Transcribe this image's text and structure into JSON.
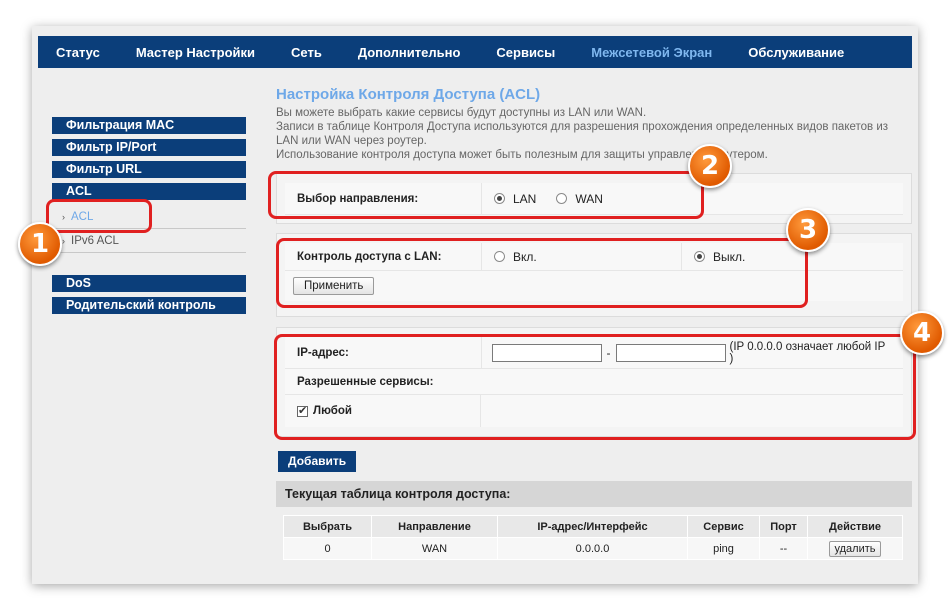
{
  "nav": {
    "items": [
      {
        "label": "Статус"
      },
      {
        "label": "Мастер Настройки"
      },
      {
        "label": "Сеть"
      },
      {
        "label": "Дополнительно"
      },
      {
        "label": "Сервисы"
      },
      {
        "label": "Межсетевой Экран"
      },
      {
        "label": "Обслуживание"
      }
    ]
  },
  "sidebar": {
    "mac": "Фильтрация MAC",
    "ipport": "Фильтр IP/Port",
    "url": "Фильтр URL",
    "acl": "ACL",
    "acl_sub": "ACL",
    "ipv6_sub": "IPv6 ACL",
    "dos": "DoS",
    "parental": "Родительский контроль"
  },
  "page": {
    "title": "Настройка Контроля Доступа (ACL)",
    "desc1": "Вы можете выбрать какие сервисы будут доступны из LAN или WAN.",
    "desc2": "Записи в таблице Контроля Доступа используются для разрешения прохождения определенных видов пакетов из LAN или WAN через роутер.",
    "desc3": "Использование контроля доступа может быть полезным для защиты управления роутером."
  },
  "direction": {
    "label": "Выбор направления:",
    "lan": "LAN",
    "wan": "WAN"
  },
  "lan_control": {
    "label": "Контроль доступа с LAN:",
    "on": "Вкл.",
    "off": "Выкл.",
    "apply": "Применить"
  },
  "ip_form": {
    "ip_label": "IP-адрес:",
    "dash": "-",
    "hint": "(IP 0.0.0.0 означает любой IP )",
    "services_label": "Разрешенные сервисы:",
    "any_label": "Любой"
  },
  "add_button": "Добавить",
  "table": {
    "title": "Текущая таблица контроля доступа:",
    "headers": [
      "Выбрать",
      "Направление",
      "IP-адрес/Интерфейс",
      "Сервис",
      "Порт",
      "Действие"
    ],
    "rows": [
      {
        "select": "0",
        "direction": "WAN",
        "ip": "0.0.0.0",
        "service": "ping",
        "port": "--",
        "action": "удалить"
      }
    ]
  },
  "badges": [
    "1",
    "2",
    "3",
    "4"
  ],
  "colors": {
    "nav_bg": "#0b3e7a",
    "accent": "#6ea8e8",
    "callout": "#e02020",
    "badge": "#e05a00"
  }
}
